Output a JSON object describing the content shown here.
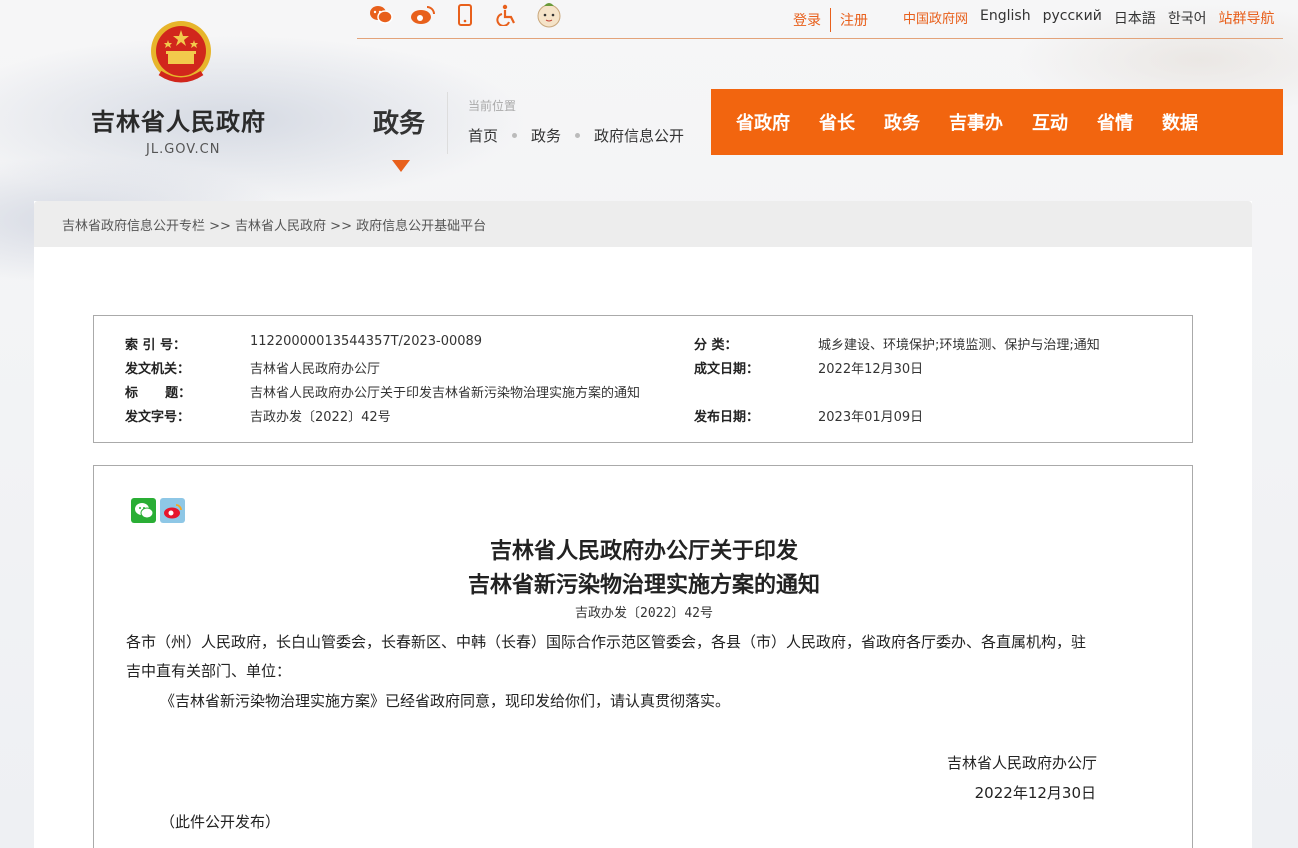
{
  "header": {
    "login": "登录",
    "register": "注册",
    "languages": [
      "中国政府网",
      "English",
      "русский",
      "日本語",
      "한국어",
      "站群导航"
    ],
    "site_name": "吉林省人民政府",
    "site_domain": "JL.GOV.CN",
    "section": "政务",
    "current_position_label": "当前位置",
    "breadcrumb": [
      "首页",
      "政务",
      "政府信息公开"
    ],
    "nav": [
      "省政府",
      "省长",
      "政务",
      "吉事办",
      "互动",
      "省情",
      "数据"
    ],
    "icons": [
      "weibo-chat-icon",
      "weibo-icon",
      "mobile-icon",
      "accessibility-icon",
      "mascot-icon"
    ],
    "accent": "#f2650f"
  },
  "content": {
    "breadcrumb": "吉林省政府信息公开专栏 >> 吉林省人民政府 >> 政府信息公开基础平台",
    "meta": {
      "index_label": "索 引 号：",
      "index_value": "11220000013544357T/2023-00089",
      "category_label": "分 类：",
      "category_value": "城乡建设、环境保护;环境监测、保护与治理;通知",
      "issuer_label": "发文机关：",
      "issuer_value": "吉林省人民政府办公厅",
      "created_label": "成文日期：",
      "created_value": "2022年12月30日",
      "title_label": "标      题：",
      "title_value": "吉林省人民政府办公厅关于印发吉林省新污染物治理实施方案的通知",
      "docno_label": "发文字号：",
      "docno_value": "吉政办发〔2022〕42号",
      "published_label": "发布日期：",
      "published_value": "2023年01月09日"
    },
    "doc": {
      "title_line1": "吉林省人民政府办公厅关于印发",
      "title_line2": "吉林省新污染物治理实施方案的通知",
      "doc_number": "吉政办发〔2022〕42号",
      "addressees_line1": "各市（州）人民政府，长白山管委会，长春新区、中韩（长春）国际合作示范区管委会，各县（市）人民政府，省政府各厅委办、各直属机构，驻",
      "addressees_line2": "吉中直有关部门、单位：",
      "body": "《吉林省新污染物治理实施方案》已经省政府同意，现印发给你们，请认真贯彻落实。",
      "signature": "吉林省人民政府办公厅",
      "date": "2022年12月30日",
      "footnote": "（此件公开发布）"
    }
  }
}
